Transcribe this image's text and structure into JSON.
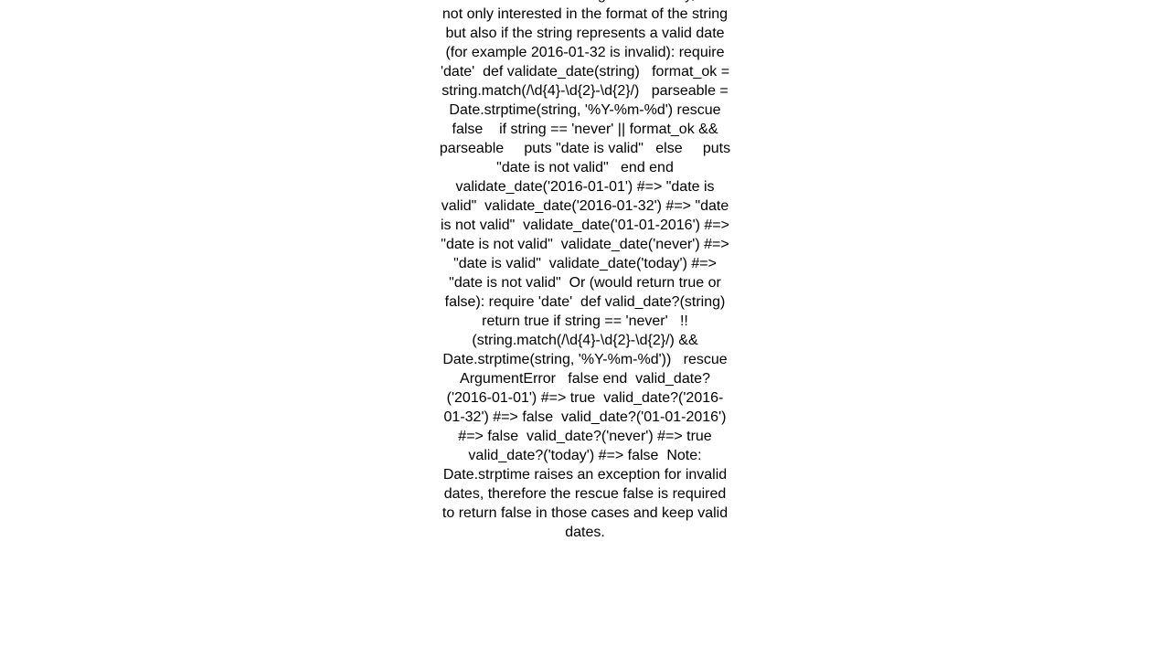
{
  "page": {
    "background_color": "#ffffff",
    "text_color": "#000000",
    "alignment": "center"
  },
  "content": {
    "body_text": "I need to validate a string date in Ruby, I am not only interested in the format of the string but also if the string represents a valid date (for example 2016-01-32 is invalid): require 'date'  def validate_date(string)   format_ok = string.match(/\\d{4}-\\d{2}-\\d{2}/)   parseable = Date.strptime(string, '%Y-%m-%d') rescue false    if string == 'never' || format_ok && parseable     puts \"date is valid\"   else     puts \"date is not valid\"   end end  validate_date('2016-01-01') #=> \"date is valid\"  validate_date('2016-01-32') #=> \"date is not valid\"  validate_date('01-01-2016') #=> \"date is not valid\"  validate_date('never') #=> \"date is valid\"  validate_date('today') #=> \"date is not valid\"  Or (would return true or false): require 'date'  def valid_date?(string)   return true if string == 'never'   !!(string.match(/\\d{4}-\\d{2}-\\d{2}/) && Date.strptime(string, '%Y-%m-%d'))   rescue ArgumentError   false end  valid_date?('2016-01-01') #=> true  valid_date?('2016-01-32') #=> false  valid_date?('01-01-2016') #=> false  valid_date?('never') #=> true  valid_date?('today') #=> false  Note: Date.strptime raises an exception for invalid dates, therefore the rescue false is required to return false in those cases and keep valid dates.",
    "visible_lines": [
      "interested in the format of the string",
      "but also if the string represents a",
      "valid date (for example 2016-01-32 is",
      "invalid): require 'date'  def",
      "validate_date(string)   format_ok =",
      "string.match(/\\d{4}-\\d{2}-\\d{2}/)",
      "parseable = Date.strptime(string,",
      "'%Y-%m-%d') rescue false    if string ==",
      "'never' || format_ok && parseable",
      "puts \"date is valid\"   else     puts",
      "\"date is not valid\"   end end",
      "validate_date('2016-01-01') #=> \"date is",
      "valid\"  validate_date('2016-01-32') #=>",
      "\"date is not valid\"",
      "validate_date('01-01-2016') #=> \"date is",
      "not valid\"  validate_date('never') #=>",
      "\"date is valid\"  validate_date('today')",
      "#=> \"date is not valid\"  Or (would",
      "return true or false): require 'date'",
      "def valid_date?(string)   return true if",
      "string == 'never'",
      "!!(string.match(/\\d{4}-\\d{2}-\\d{2}/) &&",
      "Date.strptime(string, '%Y-%m-%d'))",
      "rescue ArgumentError   false end",
      "valid_date?('2016-01-01') #=> true",
      "valid_date?('2016-01-32') #=> false",
      "valid_date?('01-01-2016') #=> false",
      "valid_date?('never') #=> true",
      "valid_date?('today') #=> false  Note:",
      "Date.strptime raises an exception for",
      "invalid dates, therefore the rescue",
      "false is required to return false in"
    ]
  }
}
